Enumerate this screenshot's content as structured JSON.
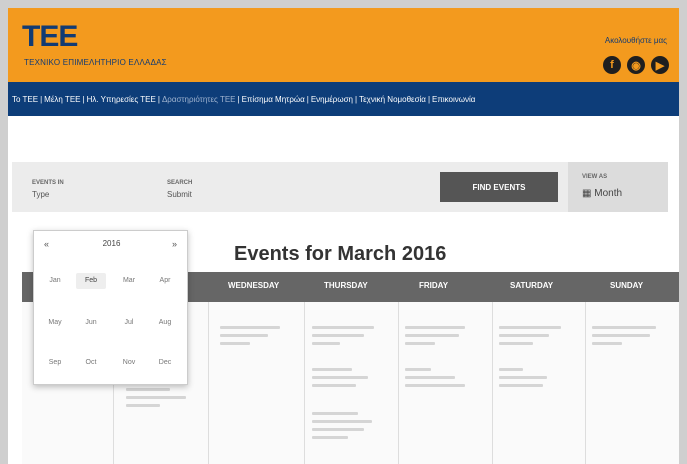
{
  "header": {
    "logo": "TEE",
    "logo_subtitle": "ΤΕΧΝΙΚΟ ΕΠΙΜΕΛΗΤΗΡΙΟ ΕΛΛΑΔΑΣ",
    "follow_text": "Ακολουθήστε μας",
    "social_icons": [
      "facebook-icon",
      "rss-icon",
      "youtube-icon"
    ]
  },
  "nav": {
    "items": [
      {
        "label": "Το ΤΕΕ",
        "dim": false
      },
      {
        "label": "Μέλη ΤΕΕ",
        "dim": false
      },
      {
        "label": "Ηλ. Υπηρεσίες ΤΕΕ",
        "dim": false
      },
      {
        "label": "Δραστηριότητες ΤΕΕ",
        "dim": true
      },
      {
        "label": "Επίσημα Μητρώα",
        "dim": false
      },
      {
        "label": "Ενημέρωση",
        "dim": false
      },
      {
        "label": "Τεχνική Νομοθεσία",
        "dim": false
      },
      {
        "label": "Επικοινωνία",
        "dim": false
      }
    ]
  },
  "filter": {
    "events_in_label": "EVENTS IN",
    "events_in_value": "Type",
    "search_label": "SEARCH",
    "search_value": "Submit",
    "find_button": "FIND EVENTS",
    "view_as_label": "VIEW AS",
    "view_as_value": "Month"
  },
  "page_title": "Events for March 2016",
  "calendar": {
    "days": [
      "WEDNESDAY",
      "THURSDAY",
      "FRIDAY",
      "SATURDAY",
      "SUNDAY"
    ]
  },
  "datepicker": {
    "year": "2016",
    "prev": "«",
    "next": "»",
    "months": [
      "Jan",
      "Feb",
      "Mar",
      "Apr",
      "May",
      "Jun",
      "Jul",
      "Aug",
      "Sep",
      "Oct",
      "Nov",
      "Dec"
    ],
    "active_month": "Feb"
  },
  "colors": {
    "header_orange": "#f39a1e",
    "nav_blue": "#0d3d79",
    "calendar_header": "#666666"
  }
}
